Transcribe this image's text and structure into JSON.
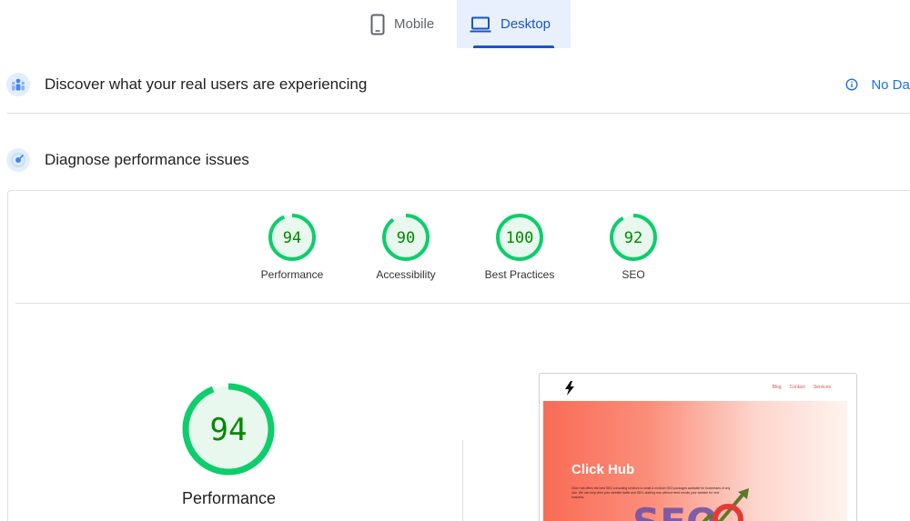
{
  "tabs": {
    "mobile": {
      "label": "Mobile",
      "icon": "smartphone-icon"
    },
    "desktop": {
      "label": "Desktop",
      "icon": "laptop-icon",
      "selected": true
    }
  },
  "field_data": {
    "title": "Discover what your real users are experiencing",
    "icon": "users-icon",
    "status": "No Dat",
    "status_icon": "info-icon"
  },
  "lab_data": {
    "title": "Diagnose performance issues",
    "icon": "diagnose-icon"
  },
  "scores": [
    {
      "label": "Performance",
      "value": "94",
      "fraction": 0.94
    },
    {
      "label": "Accessibility",
      "value": "90",
      "fraction": 0.9
    },
    {
      "label": "Best Practices",
      "value": "100",
      "fraction": 1.0
    },
    {
      "label": "SEO",
      "value": "92",
      "fraction": 0.92
    }
  ],
  "main_score": {
    "label": "Performance",
    "value": "94",
    "fraction": 0.94
  },
  "screenshot": {
    "brand": "Click Hub",
    "nav_links": [
      "Blog",
      "Contact",
      "Services"
    ],
    "body": "Click Hub offers the best SEO consulting services to small & medium SEO packages available for businesses of any size. We can help drive your website traffic and SEO, starting now without need results your website for next business.",
    "art_text": "SEO"
  },
  "colors": {
    "pass": "#0cce6b",
    "pass_text": "#008800",
    "pass_fill": "#e8f8ee",
    "accent": "#1a55c4",
    "link": "#1a73e8"
  }
}
